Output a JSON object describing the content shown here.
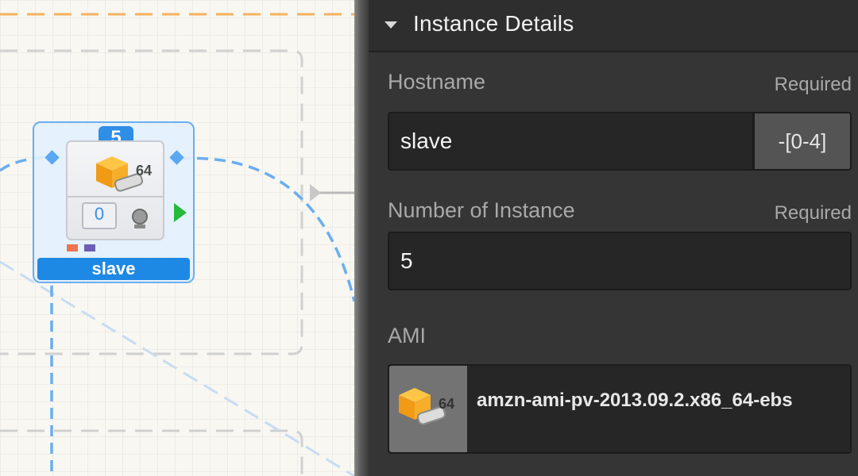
{
  "canvas": {
    "node": {
      "name": "slave",
      "instance_count": "5",
      "arch": "64",
      "volume_count": "0",
      "icons": [
        "ami-cube-icon",
        "disk-icon",
        "eip-icon",
        "port-diamond-icon",
        "play-icon"
      ],
      "tag_colors": [
        "#f0734f",
        "#6a5fb4"
      ]
    },
    "colors": {
      "accent": "#1e88e5",
      "connection": "#6aaef0",
      "group_border": "#d0d0d0",
      "vpc_border": "#f5b25f"
    }
  },
  "panel": {
    "title": "Instance Details",
    "hostname": {
      "label": "Hostname",
      "required": "Required",
      "value": "slave",
      "suffix": "-[0-4]"
    },
    "instance_count": {
      "label": "Number of Instance",
      "required": "Required",
      "value": "5"
    },
    "ami": {
      "label": "AMI",
      "name": "amzn-ami-pv-2013.09.2.x86_64-ebs",
      "arch": "64"
    }
  }
}
